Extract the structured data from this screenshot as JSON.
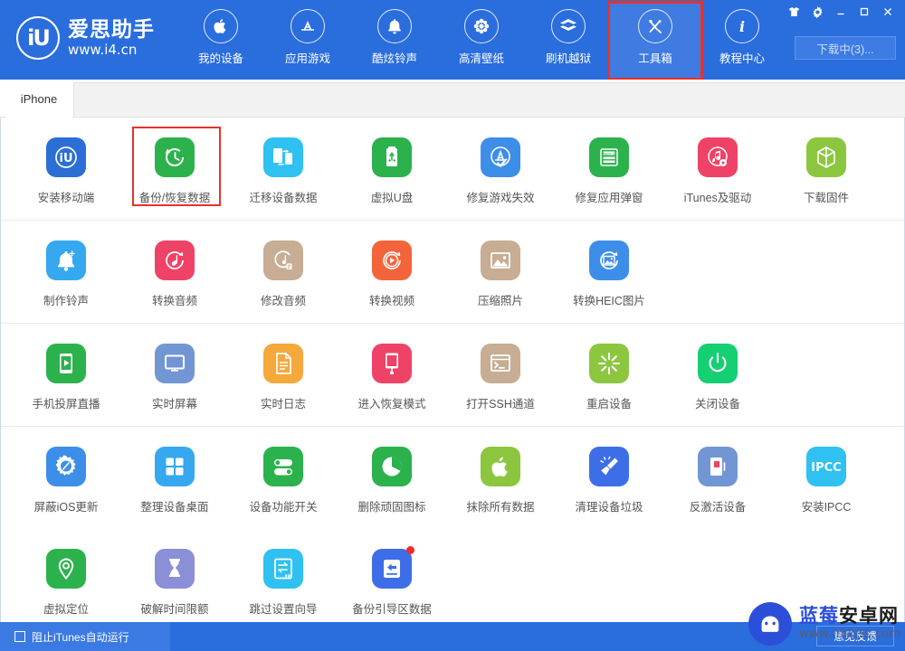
{
  "brand": {
    "logo_mark": "iU",
    "title": "爱思助手",
    "url": "www.i4.cn"
  },
  "nav": {
    "items": [
      {
        "label": "我的设备",
        "icon": "apple-icon",
        "highlight": false
      },
      {
        "label": "应用游戏",
        "icon": "appstore-icon",
        "highlight": false
      },
      {
        "label": "酷炫铃声",
        "icon": "bell-icon",
        "highlight": false
      },
      {
        "label": "高清壁纸",
        "icon": "flower-icon",
        "highlight": false
      },
      {
        "label": "刷机越狱",
        "icon": "box-open-icon",
        "highlight": false
      },
      {
        "label": "工具箱",
        "icon": "tools-icon",
        "highlight": true
      },
      {
        "label": "教程中心",
        "icon": "info-icon",
        "highlight": false
      }
    ]
  },
  "window_controls": [
    {
      "name": "skin-icon",
      "glyph": "skin"
    },
    {
      "name": "settings-icon",
      "glyph": "gear"
    },
    {
      "name": "minimize-icon",
      "glyph": "minimize"
    },
    {
      "name": "maximize-icon",
      "glyph": "maximize"
    },
    {
      "name": "close-icon",
      "glyph": "close"
    }
  ],
  "download_button": {
    "label": "下载中(3)..."
  },
  "tabs": [
    {
      "label": "iPhone",
      "active": true
    }
  ],
  "toolbox": {
    "rows": [
      [
        {
          "label": "安装移动端",
          "icon": "iu-app-icon",
          "bg": "#2b6fd6",
          "highlight": false,
          "badge": false
        },
        {
          "label": "备份/恢复数据",
          "icon": "backup-restore-icon",
          "bg": "#2bb24c",
          "highlight": true,
          "badge": false
        },
        {
          "label": "迁移设备数据",
          "icon": "device-migrate-icon",
          "bg": "#2ec1f2",
          "highlight": false,
          "badge": false
        },
        {
          "label": "虚拟U盘",
          "icon": "usb-drive-icon",
          "bg": "#2bb24c",
          "highlight": false,
          "badge": false
        },
        {
          "label": "修复游戏失效",
          "icon": "appstore-fix-icon",
          "bg": "#3d8ee8",
          "highlight": false,
          "badge": false
        },
        {
          "label": "修复应用弹窗",
          "icon": "appleid-card-icon",
          "bg": "#2bb24c",
          "highlight": false,
          "badge": false
        },
        {
          "label": "iTunes及驱动",
          "icon": "itunes-driver-icon",
          "bg": "#ef4267",
          "highlight": false,
          "badge": false
        },
        {
          "label": "下载固件",
          "icon": "firmware-cube-icon",
          "bg": "#8cc63f",
          "highlight": false,
          "badge": false
        }
      ],
      [
        {
          "label": "制作铃声",
          "icon": "ringtone-bell-icon",
          "bg": "#35a8ef",
          "highlight": false,
          "badge": false
        },
        {
          "label": "转换音频",
          "icon": "audio-convert-icon",
          "bg": "#ef4267",
          "highlight": false,
          "badge": false
        },
        {
          "label": "修改音频",
          "icon": "audio-edit-icon",
          "bg": "#c7ad93",
          "highlight": false,
          "badge": false
        },
        {
          "label": "转换视频",
          "icon": "video-convert-icon",
          "bg": "#f4643a",
          "highlight": false,
          "badge": false
        },
        {
          "label": "压缩照片",
          "icon": "photo-compress-icon",
          "bg": "#c7ad93",
          "highlight": false,
          "badge": false
        },
        {
          "label": "转换HEIC图片",
          "icon": "heic-convert-icon",
          "bg": "#3d8ee8",
          "highlight": false,
          "badge": false
        }
      ],
      [
        {
          "label": "手机投屏直播",
          "icon": "screen-cast-icon",
          "bg": "#2bb24c",
          "highlight": false,
          "badge": false
        },
        {
          "label": "实时屏幕",
          "icon": "realtime-screen-icon",
          "bg": "#7296d4",
          "highlight": false,
          "badge": false
        },
        {
          "label": "实时日志",
          "icon": "realtime-log-icon",
          "bg": "#f5a93c",
          "highlight": false,
          "badge": false
        },
        {
          "label": "进入恢复模式",
          "icon": "recovery-mode-icon",
          "bg": "#ef4267",
          "highlight": false,
          "badge": false
        },
        {
          "label": "打开SSH通道",
          "icon": "ssh-terminal-icon",
          "bg": "#c7ad93",
          "highlight": false,
          "badge": false
        },
        {
          "label": "重启设备",
          "icon": "restart-device-icon",
          "bg": "#8cc63f",
          "highlight": false,
          "badge": false
        },
        {
          "label": "关闭设备",
          "icon": "power-off-icon",
          "bg": "#15cf73",
          "highlight": false,
          "badge": false
        }
      ],
      [
        {
          "label": "屏蔽iOS更新",
          "icon": "block-update-icon",
          "bg": "#3d8ee8",
          "highlight": false,
          "badge": false
        },
        {
          "label": "整理设备桌面",
          "icon": "organize-desktop-icon",
          "bg": "#35a8ef",
          "highlight": false,
          "badge": false
        },
        {
          "label": "设备功能开关",
          "icon": "feature-toggle-icon",
          "bg": "#2bb24c",
          "highlight": false,
          "badge": false
        },
        {
          "label": "删除顽固图标",
          "icon": "delete-icon-icon",
          "bg": "#2bb24c",
          "highlight": false,
          "badge": false
        },
        {
          "label": "抹除所有数据",
          "icon": "erase-all-icon",
          "bg": "#8cc63f",
          "highlight": false,
          "badge": false
        },
        {
          "label": "清理设备垃圾",
          "icon": "clean-junk-icon",
          "bg": "#3d6ee8",
          "highlight": false,
          "badge": false
        },
        {
          "label": "反激活设备",
          "icon": "deactivate-icon",
          "bg": "#7296d4",
          "highlight": false,
          "badge": false
        },
        {
          "label": "安装IPCC",
          "icon": "ipcc-install-icon",
          "bg": "#2ec1f2",
          "highlight": false,
          "badge": false
        }
      ],
      [
        {
          "label": "虚拟定位",
          "icon": "virtual-location-icon",
          "bg": "#2bb24c",
          "highlight": false,
          "badge": false
        },
        {
          "label": "破解时间限额",
          "icon": "time-limit-icon",
          "bg": "#8b8fd8",
          "highlight": false,
          "badge": false
        },
        {
          "label": "跳过设置向导",
          "icon": "skip-setup-icon",
          "bg": "#2ec1f2",
          "highlight": false,
          "badge": false
        },
        {
          "label": "备份引导区数据",
          "icon": "backup-boot-icon",
          "bg": "#3d6ee8",
          "highlight": false,
          "badge": true
        }
      ]
    ]
  },
  "footer": {
    "block_itunes_label": "阻止iTunes自动运行",
    "feedback_label": "意见反馈"
  },
  "watermark": {
    "title_part1": "蓝莓",
    "title_part2": "安卓网",
    "url": "www.lmkjst.com"
  },
  "colors": {
    "brand_blue": "#2a6ddd",
    "highlight_red": "#e8312a",
    "badge_red": "#f02b2b"
  }
}
